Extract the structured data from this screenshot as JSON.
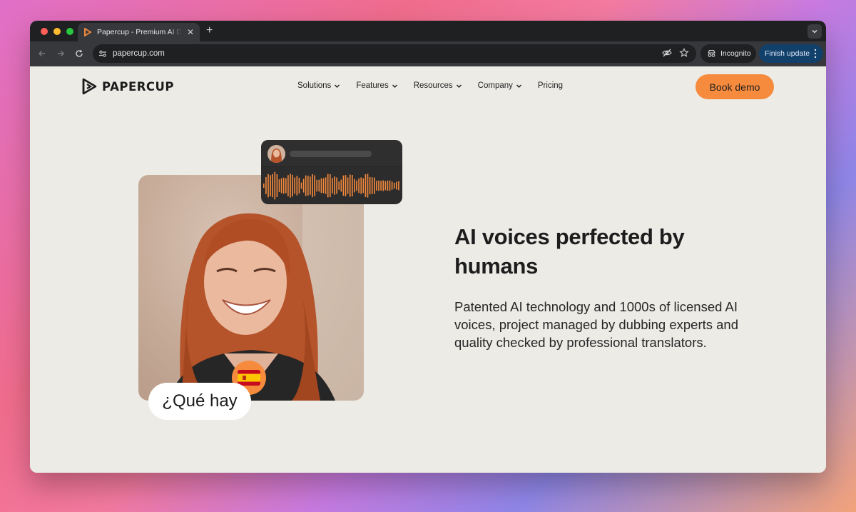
{
  "browser": {
    "traffic_colors": [
      "#ff5f57",
      "#febc2e",
      "#28c840"
    ],
    "tab_title": "Papercup - Premium AI Dubbing",
    "url": "papercup.com",
    "incognito_label": "Incognito",
    "update_label": "Finish update"
  },
  "site": {
    "logo_text": "PAPERCUP",
    "nav": [
      {
        "label": "Solutions",
        "dropdown": true
      },
      {
        "label": "Features",
        "dropdown": true
      },
      {
        "label": "Resources",
        "dropdown": true
      },
      {
        "label": "Company",
        "dropdown": true
      },
      {
        "label": "Pricing",
        "dropdown": false
      }
    ],
    "cta_label": "Book demo",
    "accent": "#f68b3e"
  },
  "hero": {
    "caption": "¿Qué hay",
    "flag_icon": "spain-flag-icon",
    "headline": "AI voices perfected by humans",
    "subtext": "Patented AI technology and 1000s of licensed AI voices, project managed by dubbing experts and quality checked by professional translators."
  }
}
